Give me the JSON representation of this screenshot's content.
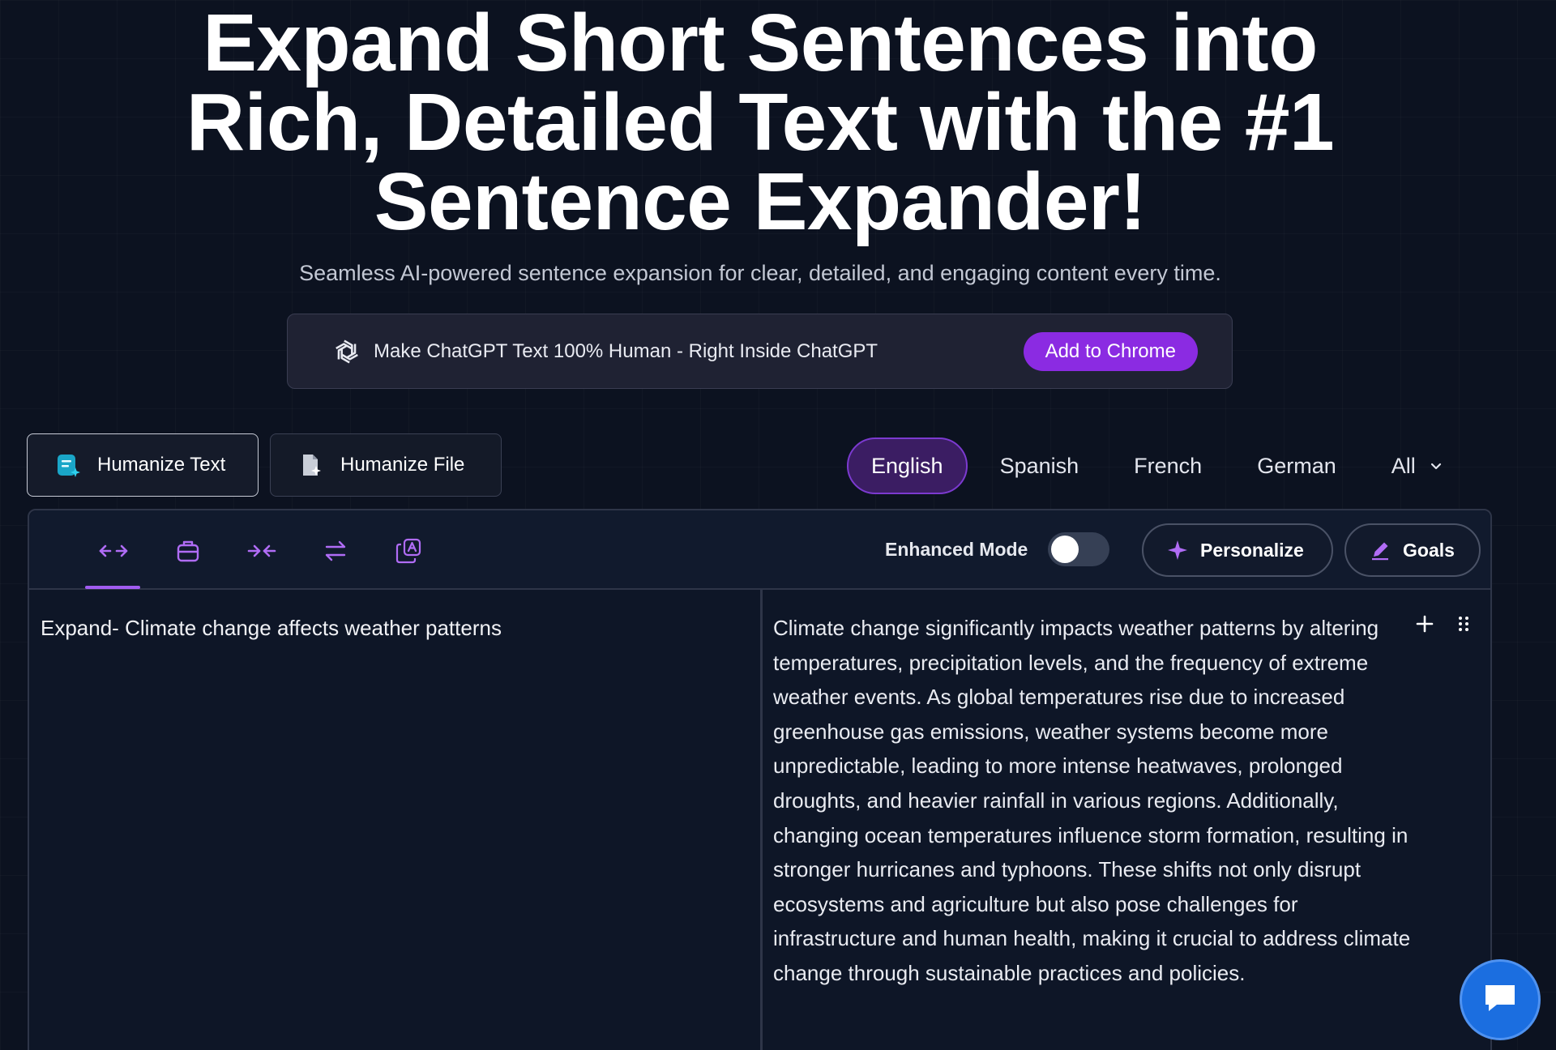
{
  "hero": {
    "title_line1": "Expand Short Sentences into",
    "title_line2": "Rich, Detailed Text with the #1",
    "title_line3": "Sentence Expander!",
    "subtitle": "Seamless AI-powered sentence expansion for clear, detailed, and engaging content every time."
  },
  "banner": {
    "icon": "openai-icon",
    "text": "Make ChatGPT Text 100% Human - Right Inside ChatGPT",
    "button_label": "Add to Chrome"
  },
  "mode_tabs": [
    {
      "label": "Humanize Text",
      "icon": "document-sparkle-icon",
      "active": true
    },
    {
      "label": "Humanize File",
      "icon": "file-sparkle-icon",
      "active": false
    }
  ],
  "languages": [
    {
      "label": "English",
      "active": true
    },
    {
      "label": "Spanish",
      "active": false
    },
    {
      "label": "French",
      "active": false
    },
    {
      "label": "German",
      "active": false
    },
    {
      "label": "All",
      "active": false
    }
  ],
  "toolbar": {
    "tools": [
      "expand-icon",
      "briefcase-icon",
      "shorten-icon",
      "swap-icon",
      "copy-a-icon"
    ],
    "enhanced_mode_label": "Enhanced Mode",
    "enhanced_mode_on": false,
    "personalize_label": "Personalize",
    "goals_label": "Goals"
  },
  "editor": {
    "input": "Expand- Climate change affects weather patterns",
    "output": "Climate change significantly impacts weather patterns by altering temperatures, precipitation levels, and the frequency of extreme weather events. As global temperatures rise due to increased greenhouse gas emissions, weather systems become more unpredictable, leading to more intense heatwaves, prolonged droughts, and heavier rainfall in various regions. Additionally, changing ocean temperatures influence storm formation, resulting in stronger hurricanes and typhoons. These shifts not only disrupt ecosystems and agriculture but also pose challenges for infrastructure and human health, making it crucial to address climate change through sustainable practices and policies."
  },
  "colors": {
    "background": "#0c1220",
    "accent": "#8b2be2",
    "active_lang_bg": "#3b1d63",
    "chat_button": "#1b6ee0"
  }
}
